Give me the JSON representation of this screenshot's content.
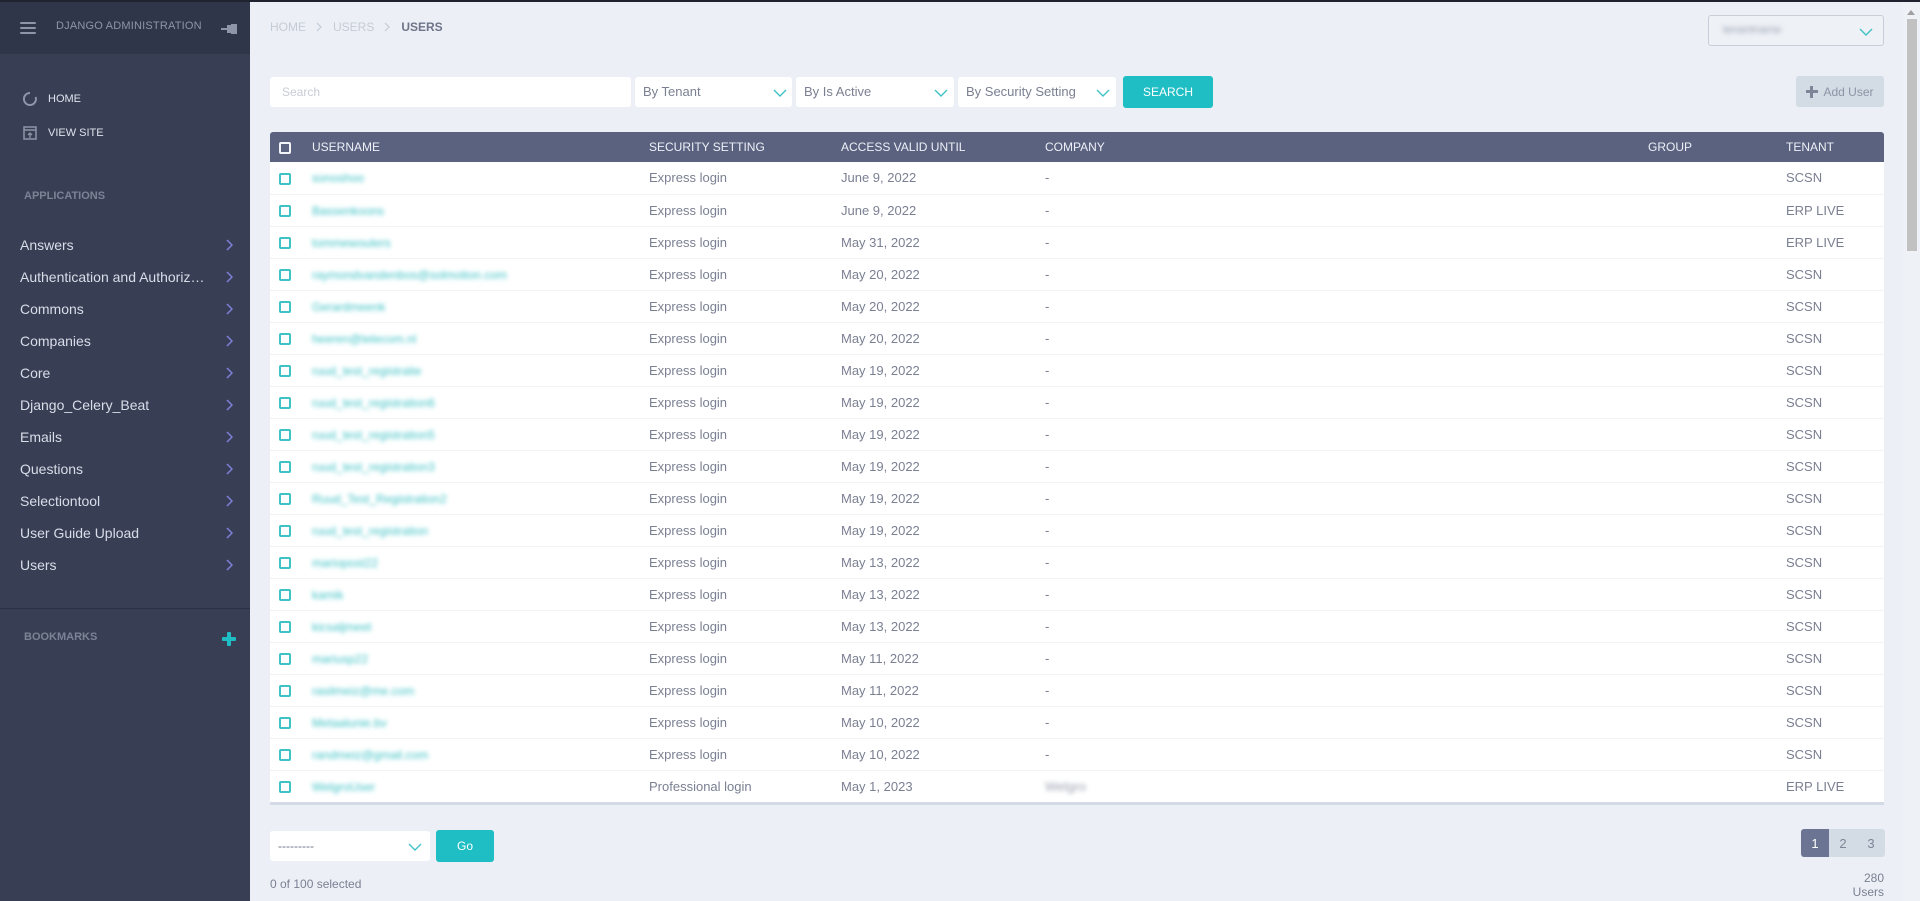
{
  "sidebar": {
    "brand": "Django Administration",
    "quick_links": [
      {
        "label": "Home",
        "icon": "home-icon"
      },
      {
        "label": "View Site",
        "icon": "view-site-icon"
      }
    ],
    "applications_title": "Applications",
    "apps": [
      {
        "label": "Answers"
      },
      {
        "label": "Authentication and Authoriz…"
      },
      {
        "label": "Commons"
      },
      {
        "label": "Companies"
      },
      {
        "label": "Core"
      },
      {
        "label": "Django_Celery_Beat"
      },
      {
        "label": "Emails"
      },
      {
        "label": "Questions"
      },
      {
        "label": "Selectiontool"
      },
      {
        "label": "User Guide Upload"
      },
      {
        "label": "Users"
      }
    ],
    "bookmarks_title": "Bookmarks"
  },
  "header": {
    "breadcrumb": [
      "Home",
      "Users",
      "Users"
    ],
    "tenant_switch_value": "tenantname"
  },
  "filters": {
    "search_placeholder": "Search",
    "tenant": "By Tenant",
    "is_active": "By Is Active",
    "security_setting": "By Security Setting",
    "search_button": "Search",
    "add_user": "Add User"
  },
  "table": {
    "columns": [
      "Username",
      "Security Setting",
      "Access Valid Until",
      "Company",
      "Group",
      "Tenant"
    ],
    "rows": [
      {
        "username": "sonoshoo",
        "security": "Express login",
        "access": "June 9, 2022",
        "company": "-",
        "group": "",
        "tenant": "SCSN"
      },
      {
        "username": "Bassenkoons",
        "security": "Express login",
        "access": "June 9, 2022",
        "company": "-",
        "group": "",
        "tenant": "ERP LIVE"
      },
      {
        "username": "tommewouters",
        "security": "Express login",
        "access": "May 31, 2022",
        "company": "-",
        "group": "",
        "tenant": "ERP LIVE"
      },
      {
        "username": "raymondvandenbos@solmotion.com",
        "security": "Express login",
        "access": "May 20, 2022",
        "company": "-",
        "group": "",
        "tenant": "SCSN"
      },
      {
        "username": "Gerardmeenk",
        "security": "Express login",
        "access": "May 20, 2022",
        "company": "-",
        "group": "",
        "tenant": "SCSN"
      },
      {
        "username": "heeren@telecom.nl",
        "security": "Express login",
        "access": "May 20, 2022",
        "company": "-",
        "group": "",
        "tenant": "SCSN"
      },
      {
        "username": "ruud_test_registratie",
        "security": "Express login",
        "access": "May 19, 2022",
        "company": "-",
        "group": "",
        "tenant": "SCSN"
      },
      {
        "username": "ruud_test_registration6",
        "security": "Express login",
        "access": "May 19, 2022",
        "company": "-",
        "group": "",
        "tenant": "SCSN"
      },
      {
        "username": "ruud_test_registration5",
        "security": "Express login",
        "access": "May 19, 2022",
        "company": "-",
        "group": "",
        "tenant": "SCSN"
      },
      {
        "username": "ruud_test_registration3",
        "security": "Express login",
        "access": "May 19, 2022",
        "company": "-",
        "group": "",
        "tenant": "SCSN"
      },
      {
        "username": "Ruud_Test_Registration2",
        "security": "Express login",
        "access": "May 19, 2022",
        "company": "-",
        "group": "",
        "tenant": "SCSN"
      },
      {
        "username": "ruud_test_registration",
        "security": "Express login",
        "access": "May 19, 2022",
        "company": "-",
        "group": "",
        "tenant": "SCSN"
      },
      {
        "username": "mariopost22",
        "security": "Express login",
        "access": "May 13, 2022",
        "company": "-",
        "group": "",
        "tenant": "SCSN"
      },
      {
        "username": "kamik",
        "security": "Express login",
        "access": "May 13, 2022",
        "company": "-",
        "group": "",
        "tenant": "SCSN"
      },
      {
        "username": "kicsaljmeet",
        "security": "Express login",
        "access": "May 13, 2022",
        "company": "-",
        "group": "",
        "tenant": "SCSN"
      },
      {
        "username": "mariusp22",
        "security": "Express login",
        "access": "May 11, 2022",
        "company": "-",
        "group": "",
        "tenant": "SCSN"
      },
      {
        "username": "rasilmeiz@me.com",
        "security": "Express login",
        "access": "May 11, 2022",
        "company": "-",
        "group": "",
        "tenant": "SCSN"
      },
      {
        "username": "Metaalunie.bv",
        "security": "Express login",
        "access": "May 10, 2022",
        "company": "-",
        "group": "",
        "tenant": "SCSN"
      },
      {
        "username": "randmeiz@gmail.com",
        "security": "Express login",
        "access": "May 10, 2022",
        "company": "-",
        "group": "",
        "tenant": "SCSN"
      },
      {
        "username": "WelgroUser",
        "security": "Professional login",
        "access": "May 1, 2023",
        "company": "Welgro",
        "company_blurred": true,
        "group": "",
        "tenant": "ERP LIVE"
      }
    ]
  },
  "footer": {
    "action_select": "---------",
    "go_button": "Go",
    "selected_text": "0 of 100 selected",
    "pages": [
      "1",
      "2",
      "3"
    ],
    "current_page": "1",
    "total": "280 Users"
  },
  "colors": {
    "accent": "#1fbec4",
    "sidebar_bg": "#383f55",
    "table_header_bg": "#5a6280",
    "page_bg": "#ecf0f6"
  }
}
